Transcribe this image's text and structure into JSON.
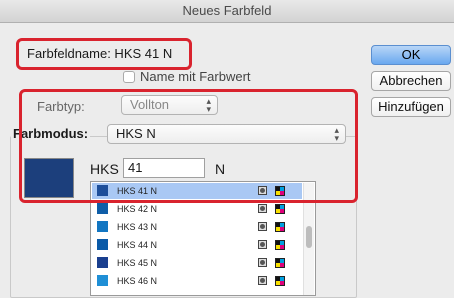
{
  "window": {
    "title": "Neues Farbfeld"
  },
  "swatch_name": {
    "label": "Farbfeldname: HKS 41 N"
  },
  "name_with_value": {
    "label": "Name mit Farbwert",
    "checked": false
  },
  "buttons": {
    "ok": "OK",
    "cancel": "Abbrechen",
    "add": "Hinzufügen"
  },
  "color_type": {
    "label": "Farbtyp:",
    "value": "Vollton"
  },
  "color_mode": {
    "label": "Farbmodus:",
    "value": "HKS N"
  },
  "hks_input": {
    "prefix": "HKS",
    "value": "41",
    "suffix": "N"
  },
  "current_color": "#1c3f7c",
  "colors": {
    "highlight": "#d9232e",
    "selection": "#a9c8f4",
    "default_button": "#6aa8ef"
  },
  "swatch_list": [
    {
      "name": "HKS 41 N",
      "color": "#1d4e9a",
      "selected": true
    },
    {
      "name": "HKS 42 N",
      "color": "#0f5ea8",
      "selected": false
    },
    {
      "name": "HKS 43 N",
      "color": "#1276c2",
      "selected": false
    },
    {
      "name": "HKS 44 N",
      "color": "#0a5aa8",
      "selected": false
    },
    {
      "name": "HKS 45 N",
      "color": "#1a3f8f",
      "selected": false
    },
    {
      "name": "HKS 46 N",
      "color": "#1f8fd6",
      "selected": false
    }
  ]
}
